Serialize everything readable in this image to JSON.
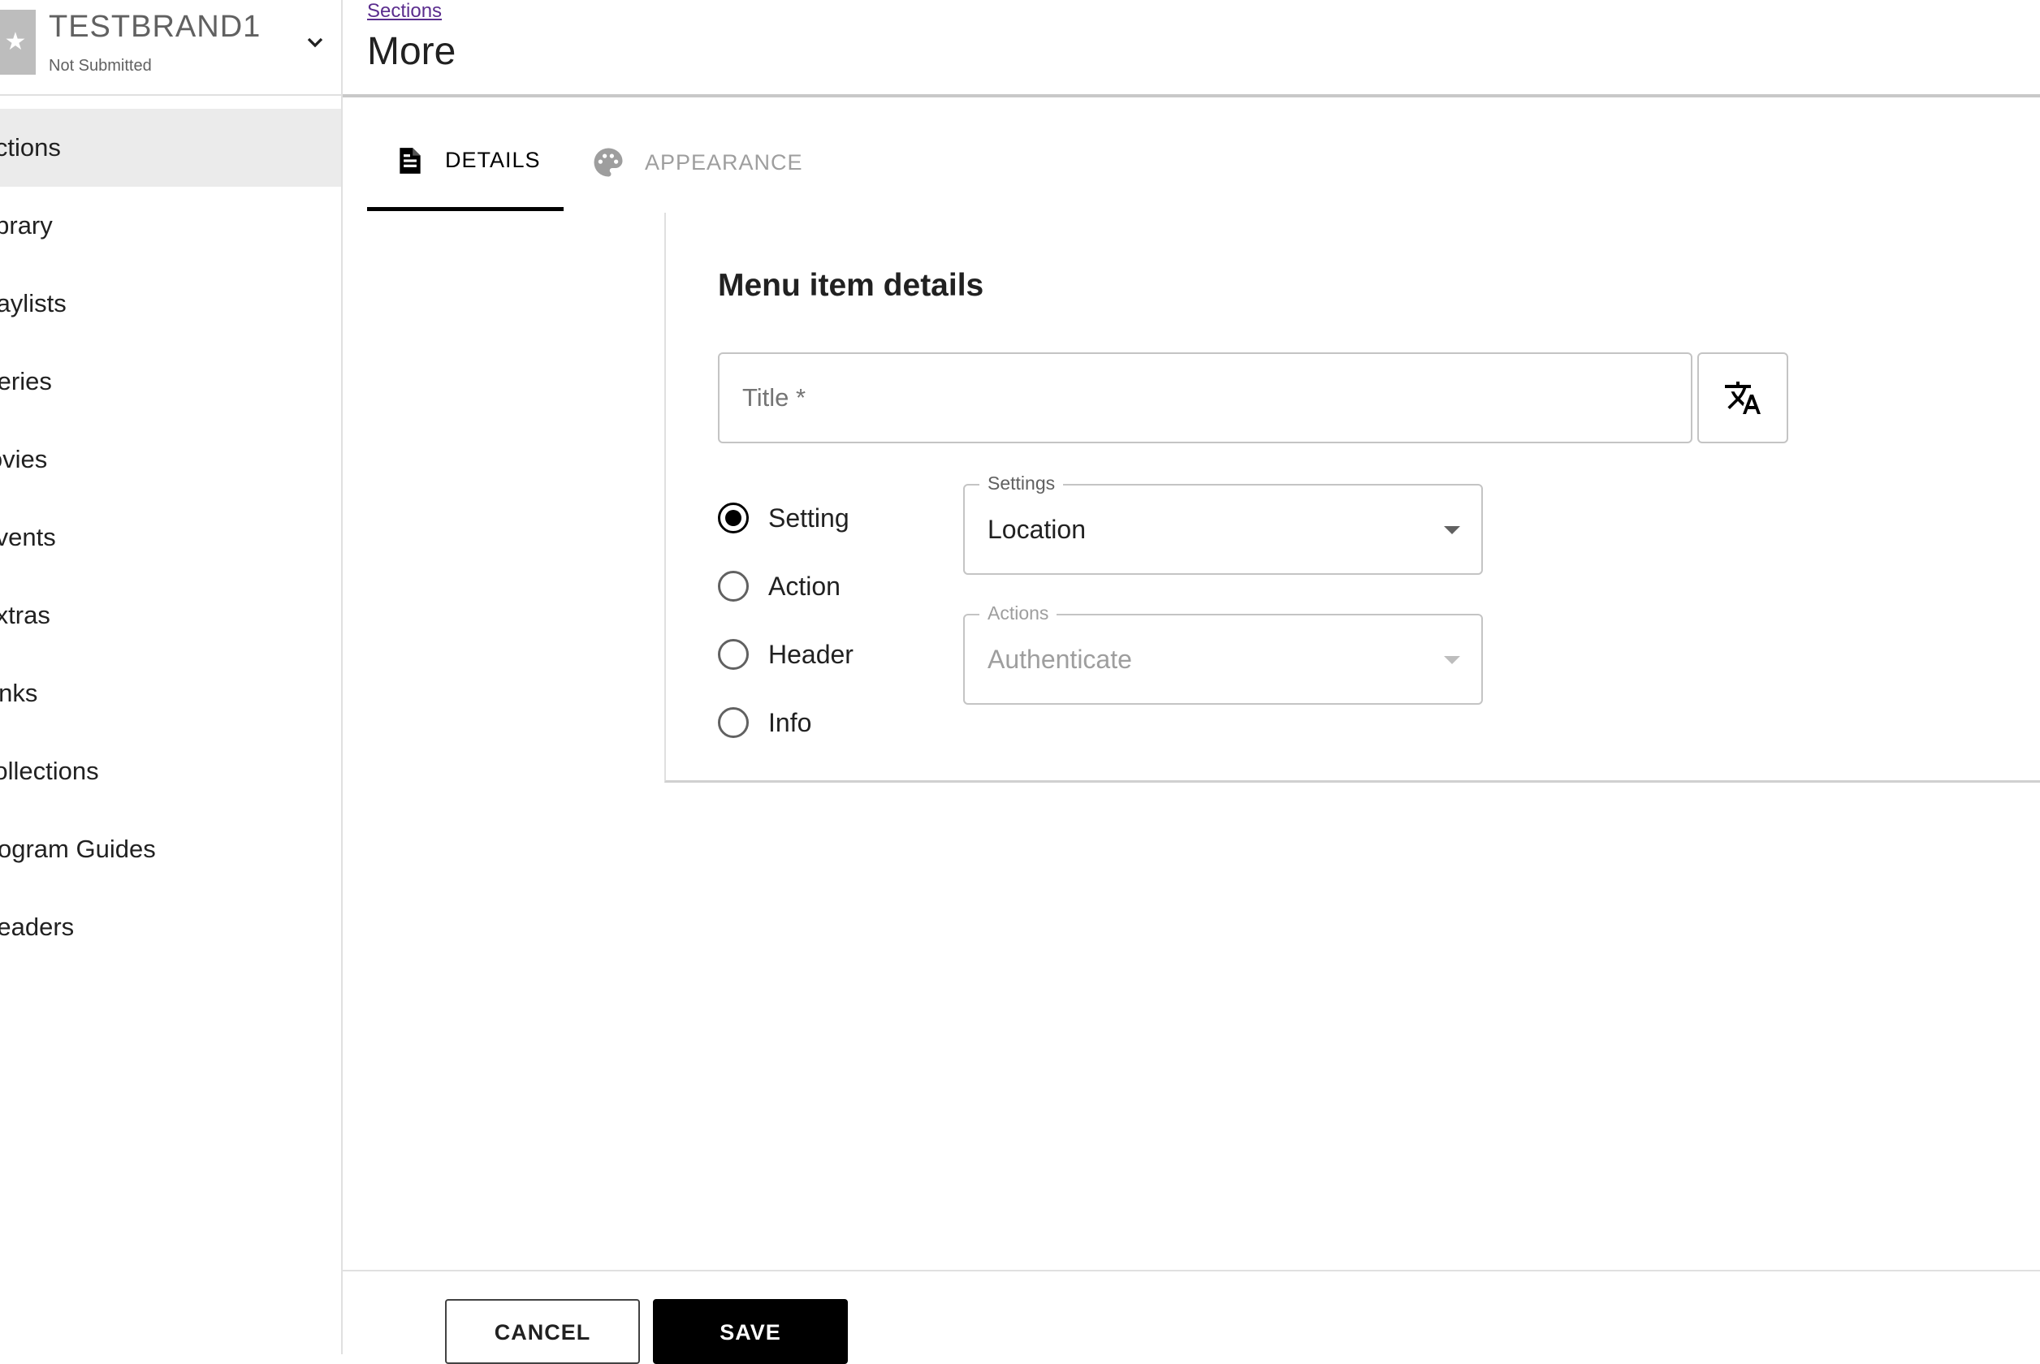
{
  "brand": {
    "logo_glyph": "★",
    "name": "TESTBRAND1",
    "status": "Not Submitted"
  },
  "sidebar": {
    "items": [
      {
        "label": "Sections",
        "active": true
      },
      {
        "label": "Library"
      },
      {
        "label": "Playlists"
      },
      {
        "label": "Series"
      },
      {
        "label": "Movies"
      },
      {
        "label": "Events"
      },
      {
        "label": "Extras"
      },
      {
        "label": "Links"
      },
      {
        "label": "Collections"
      },
      {
        "label": "Program Guides"
      },
      {
        "label": "Headers"
      }
    ]
  },
  "header": {
    "breadcrumb": "Sections",
    "title": "More"
  },
  "tabs": [
    {
      "label": "DETAILS",
      "icon": "document-icon",
      "active": true
    },
    {
      "label": "APPEARANCE",
      "icon": "palette-icon",
      "active": false
    }
  ],
  "form": {
    "heading": "Menu item details",
    "title_placeholder": "Title *",
    "translate_icon": "translate-icon",
    "radios": [
      {
        "label": "Setting",
        "checked": true
      },
      {
        "label": "Action",
        "checked": false
      },
      {
        "label": "Header",
        "checked": false
      },
      {
        "label": "Info",
        "checked": false
      }
    ],
    "settings_select": {
      "legend": "Settings",
      "value": "Location"
    },
    "actions_select": {
      "legend": "Actions",
      "value": "Authenticate",
      "disabled": true
    }
  },
  "footer": {
    "cancel_label": "CANCEL",
    "save_label": "SAVE"
  },
  "colors": {
    "accent": "#000000",
    "link": "#5b2d8e",
    "active_nav_bg": "#ebebeb"
  }
}
